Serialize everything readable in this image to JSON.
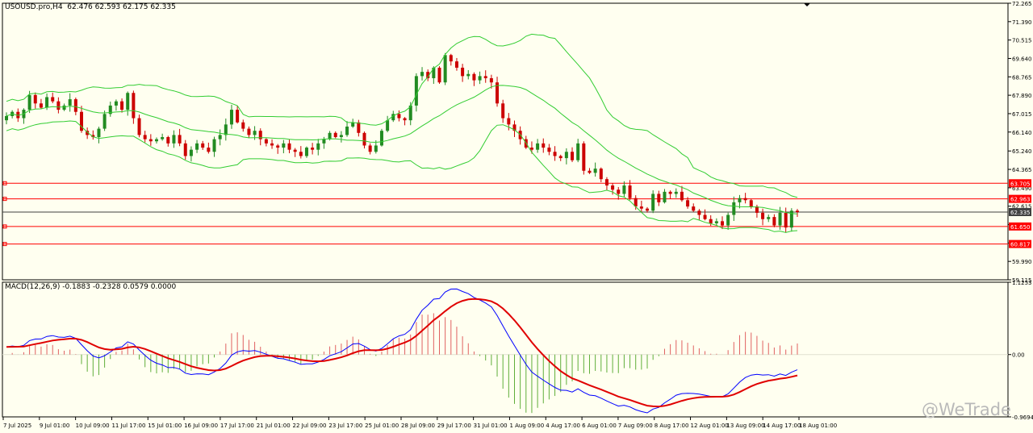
{
  "header": {
    "symbol": "USOUSD.pro,H4",
    "ohlc": "62.476 62.593 62.175 62.335"
  },
  "macd_header": {
    "label": "MACD(12,26,9) -0.1883 -0.2328 0.0579 0.0000"
  },
  "watermark": "@WeTrade",
  "colors": {
    "background": "#fffff0",
    "bull_candle": "#228b22",
    "bear_candle": "#cc0000",
    "bollinger": "#32cd32",
    "level_line": "#ff0000",
    "price_line": "#404040",
    "macd_line": "#0000ff",
    "signal_line": "#e00000",
    "hist_positive": "#e06060",
    "hist_negative": "#5fae3a"
  },
  "price_axis": {
    "ticks": [
      "72.265",
      "71.390",
      "70.515",
      "69.640",
      "68.765",
      "67.890",
      "67.015",
      "66.140",
      "65.240",
      "64.365",
      "63.490",
      "62.615",
      "61.740",
      "60.865",
      "59.990",
      "59.115"
    ]
  },
  "price_labels": [
    {
      "value": "63.705",
      "kind": "level"
    },
    {
      "value": "62.963",
      "kind": "level"
    },
    {
      "value": "62.335",
      "kind": "current"
    },
    {
      "value": "61.650",
      "kind": "level"
    },
    {
      "value": "60.817",
      "kind": "level"
    }
  ],
  "macd_axis": {
    "ticks": [
      "1.1253",
      "0.00",
      "-0.9694"
    ]
  },
  "time_axis": {
    "ticks": [
      "7 Jul 2025",
      "9 Jul 01:00",
      "10 Jul 09:00",
      "11 Jul 17:00",
      "15 Jul 01:00",
      "16 Jul 09:00",
      "17 Jul 17:00",
      "21 Jul 01:00",
      "22 Jul 09:00",
      "23 Jul 17:00",
      "25 Jul 01:00",
      "28 Jul 09:00",
      "29 Jul 17:00",
      "31 Jul 01:00",
      "1 Aug 09:00",
      "4 Aug 17:00",
      "6 Aug 01:00",
      "7 Aug 09:00",
      "8 Aug 17:00",
      "12 Aug 01:00",
      "13 Aug 09:00",
      "14 Aug 17:00",
      "18 Aug 01:00"
    ]
  },
  "chart_data": [
    {
      "type": "candlestick",
      "title": "USOUSD.pro,H4",
      "ylim": [
        59.115,
        72.265
      ],
      "horizontal_levels": [
        63.705,
        62.963,
        61.65,
        60.817
      ],
      "current_price": 62.335,
      "closes": [
        66.9,
        67.1,
        66.8,
        67.2,
        67.9,
        67.5,
        67.3,
        67.8,
        67.6,
        67.2,
        67.4,
        67.7,
        67.1,
        66.2,
        66.0,
        65.9,
        66.3,
        67.0,
        67.4,
        67.6,
        67.2,
        68.0,
        66.8,
        66.0,
        65.8,
        65.7,
        65.8,
        65.9,
        65.6,
        66.0,
        65.6,
        65.0,
        65.3,
        65.6,
        65.4,
        65.2,
        65.8,
        66.0,
        66.5,
        67.2,
        66.6,
        66.3,
        66.0,
        66.2,
        65.8,
        65.6,
        65.5,
        65.4,
        65.6,
        65.3,
        65.2,
        65.0,
        65.4,
        65.3,
        65.6,
        65.8,
        66.1,
        65.9,
        66.0,
        66.4,
        66.6,
        66.1,
        65.5,
        65.2,
        65.5,
        66.2,
        66.7,
        67.0,
        66.8,
        66.7,
        67.4,
        68.8,
        69.0,
        68.7,
        69.2,
        68.5,
        69.8,
        69.5,
        69.2,
        68.8,
        68.9,
        68.6,
        68.8,
        68.7,
        68.5,
        67.5,
        66.8,
        66.5,
        66.2,
        65.8,
        65.4,
        65.3,
        65.6,
        65.4,
        65.2,
        65.0,
        64.9,
        65.2,
        64.8,
        65.6,
        64.3,
        64.2,
        64.4,
        63.9,
        63.6,
        63.4,
        63.2,
        63.6,
        63.0,
        62.6,
        62.5,
        62.4,
        63.2,
        62.8,
        63.3,
        63.2,
        63.3,
        62.9,
        62.6,
        62.4,
        62.2,
        62.0,
        61.8,
        61.9,
        61.7,
        62.2,
        62.8,
        63.0,
        62.9,
        62.6,
        62.3,
        62.0,
        62.1,
        61.7,
        62.3,
        61.6,
        62.4,
        62.335
      ]
    },
    {
      "type": "macd",
      "title": "MACD(12,26,9)",
      "ylim": [
        -0.9694,
        1.1253
      ],
      "macd": -0.1883,
      "signal": -0.2328
    }
  ]
}
